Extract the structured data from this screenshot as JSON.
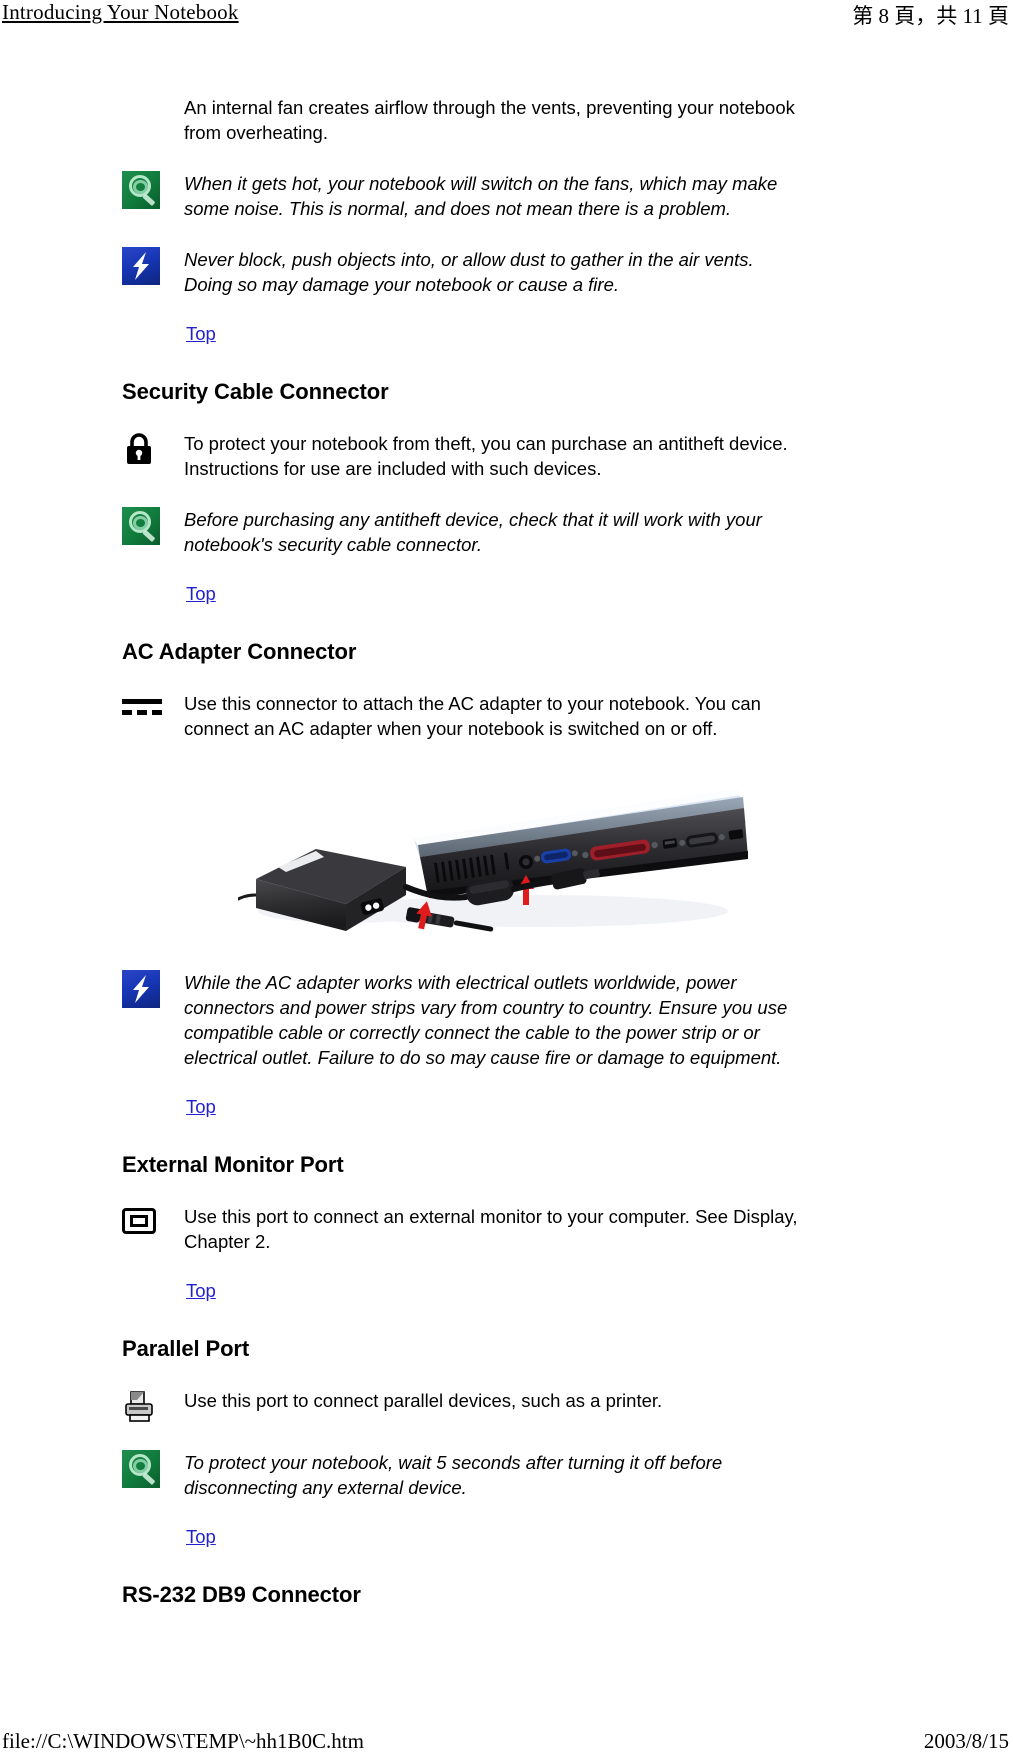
{
  "header": {
    "title": "Introducing Your Notebook",
    "page_indicator": "第 8 頁，共 11 頁"
  },
  "footer": {
    "url": "file://C:\\WINDOWS\\TEMP\\~hh1B0C.htm",
    "date": "2003/8/15"
  },
  "sections": {
    "fan_paragraph": "An internal fan creates airflow through the vents, preventing your notebook from overheating.",
    "fan_note": "When it gets hot, your notebook will switch on the fans, which may make some noise. This is normal, and does not mean there is a problem.",
    "fan_warning": "Never block, push objects into, or allow dust to gather in the air vents. Doing so may damage your notebook or cause a fire.",
    "security_heading": "Security Cable Connector",
    "security_body": "To protect your notebook from theft, you can purchase an antitheft device. Instructions for use are included with such devices.",
    "security_note": "Before purchasing any antitheft device, check that it will work with your notebook's security cable connector.",
    "ac_heading": "AC Adapter Connector",
    "ac_body": "Use this connector to attach the AC adapter to your notebook. You can connect an AC adapter when your notebook is switched on or off.",
    "ac_warning": "While the AC adapter works with electrical outlets worldwide, power connectors and power strips vary from country to country. Ensure you use compatible cable or correctly connect the cable to the power strip or or electrical outlet. Failure to do so may cause fire or damage to equipment.",
    "monitor_heading": "External Monitor Port",
    "monitor_body": "Use this port to connect an external monitor to your computer. See Display, Chapter 2.",
    "parallel_heading": "Parallel Port",
    "parallel_body": "Use this port to connect parallel devices, such as a printer.",
    "parallel_note": "To protect your notebook, wait 5 seconds after turning it off before disconnecting any external device.",
    "rs232_heading": "RS-232 DB9 Connector"
  },
  "links": {
    "top": "Top"
  },
  "icons": {
    "note": "magnifier-note-icon",
    "warning": "lightning-warning-icon",
    "lock": "padlock-icon",
    "dc_in": "dc-power-icon",
    "monitor": "external-monitor-icon",
    "printer": "printer-icon"
  },
  "colors": {
    "link": "#2222cc",
    "note_icon_green": "#0f7a3c",
    "warning_icon_blue": "#1636b4",
    "text": "#000000",
    "vga_port_blue": "#1a3fa8",
    "parallel_port_red": "#9e1f2a",
    "arrow_red": "#e01b1b"
  },
  "photo": {
    "caption": "AC adapter brick with power cable connected to the rear port panel of the notebook",
    "alt": "ac-adapter-and-notebook-rear-ports"
  }
}
